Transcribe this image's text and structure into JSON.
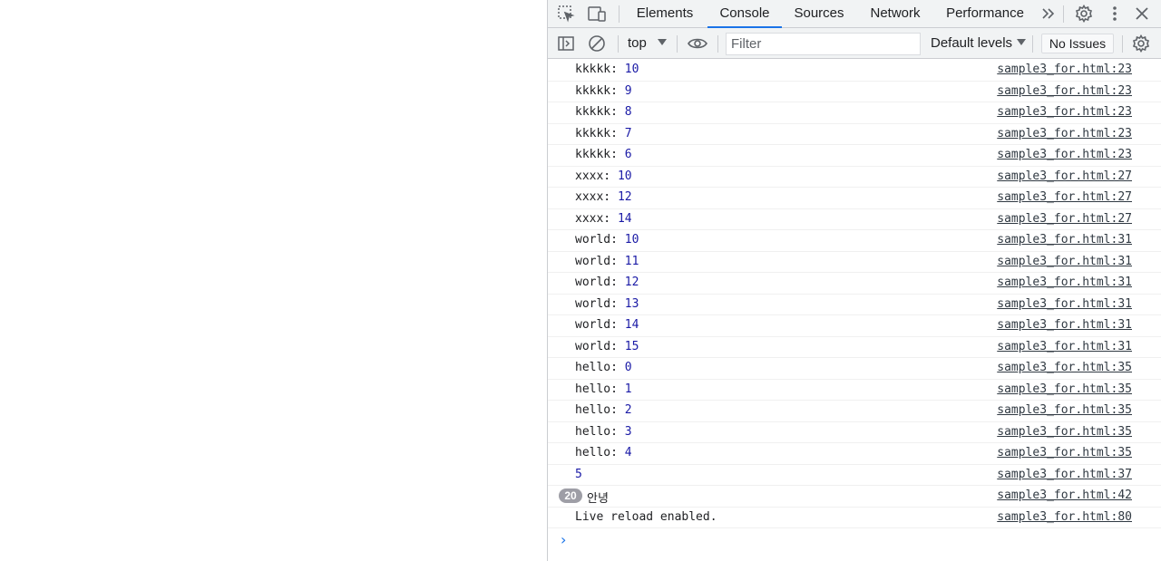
{
  "tabs": [
    {
      "label": "Elements",
      "active": false
    },
    {
      "label": "Console",
      "active": true
    },
    {
      "label": "Sources",
      "active": false
    },
    {
      "label": "Network",
      "active": false
    },
    {
      "label": "Performance",
      "active": false
    }
  ],
  "toolbar": {
    "context": "top",
    "filter_placeholder": "Filter",
    "levels": "Default levels",
    "issues": "No Issues"
  },
  "log": [
    {
      "label": "kkkkk: ",
      "value": "10",
      "source": "sample3_for.html:23"
    },
    {
      "label": "kkkkk: ",
      "value": "9",
      "source": "sample3_for.html:23"
    },
    {
      "label": "kkkkk: ",
      "value": "8",
      "source": "sample3_for.html:23"
    },
    {
      "label": "kkkkk: ",
      "value": "7",
      "source": "sample3_for.html:23"
    },
    {
      "label": "kkkkk: ",
      "value": "6",
      "source": "sample3_for.html:23"
    },
    {
      "label": "xxxx: ",
      "value": "10",
      "source": "sample3_for.html:27"
    },
    {
      "label": "xxxx: ",
      "value": "12",
      "source": "sample3_for.html:27"
    },
    {
      "label": "xxxx: ",
      "value": "14",
      "source": "sample3_for.html:27"
    },
    {
      "label": "world: ",
      "value": "10",
      "source": "sample3_for.html:31"
    },
    {
      "label": "world: ",
      "value": "11",
      "source": "sample3_for.html:31"
    },
    {
      "label": "world: ",
      "value": "12",
      "source": "sample3_for.html:31"
    },
    {
      "label": "world: ",
      "value": "13",
      "source": "sample3_for.html:31"
    },
    {
      "label": "world: ",
      "value": "14",
      "source": "sample3_for.html:31"
    },
    {
      "label": "world: ",
      "value": "15",
      "source": "sample3_for.html:31"
    },
    {
      "label": "hello: ",
      "value": "0",
      "source": "sample3_for.html:35"
    },
    {
      "label": "hello: ",
      "value": "1",
      "source": "sample3_for.html:35"
    },
    {
      "label": "hello: ",
      "value": "2",
      "source": "sample3_for.html:35"
    },
    {
      "label": "hello: ",
      "value": "3",
      "source": "sample3_for.html:35"
    },
    {
      "label": "hello: ",
      "value": "4",
      "source": "sample3_for.html:35"
    },
    {
      "label": "",
      "value": "5",
      "source": "sample3_for.html:37"
    }
  ],
  "grouped": {
    "count": "20",
    "text": "안녕",
    "source": "sample3_for.html:42"
  },
  "live_reload": {
    "text": "Live reload enabled.",
    "source": "sample3_for.html:80"
  },
  "prompt_symbol": "›",
  "colors": {
    "accent": "#1a73e8",
    "number": "#1a1aa6",
    "badge": "#9e9ea6"
  }
}
